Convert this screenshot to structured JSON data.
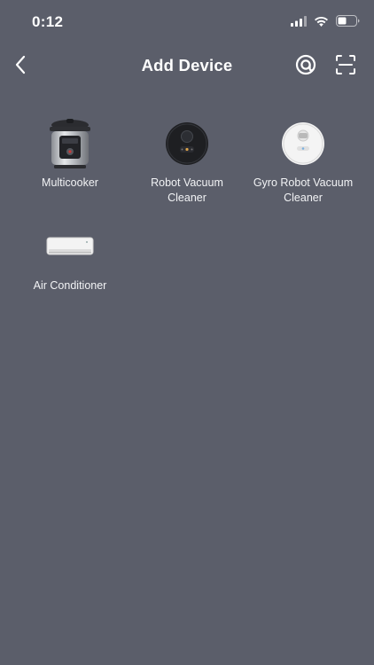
{
  "status_bar": {
    "time": "0:12"
  },
  "header": {
    "title": "Add Device",
    "back_icon": "chevron-left-icon",
    "actions": [
      {
        "name": "nearby-scan-icon"
      },
      {
        "name": "scan-code-icon"
      }
    ]
  },
  "devices": [
    {
      "label": "Multicooker",
      "icon": "multicooker-image"
    },
    {
      "label": "Robot Vacuum Cleaner",
      "icon": "robot-vacuum-image"
    },
    {
      "label": "Gyro Robot Vacuum Cleaner",
      "icon": "gyro-robot-vacuum-image"
    },
    {
      "label": "Air Conditioner",
      "icon": "air-conditioner-image"
    }
  ],
  "colors": {
    "background": "#5b5e6a",
    "text": "#ffffff"
  }
}
